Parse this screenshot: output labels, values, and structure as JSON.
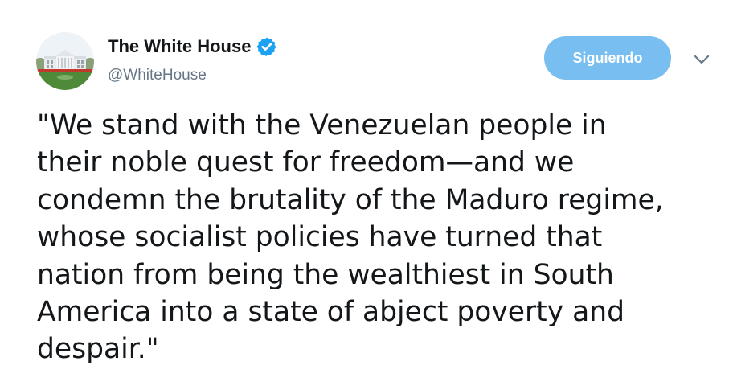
{
  "account": {
    "display_name": "The White House",
    "handle": "@WhiteHouse",
    "verified": true
  },
  "actions": {
    "follow_label": "Siguiendo",
    "menu_icon": "chevron-down-icon"
  },
  "tweet": {
    "lines": [
      "\"We stand with the Venezuelan people in",
      "their noble quest for freedom—and we",
      "condemn the brutality of the Maduro regime,",
      "whose socialist policies have turned that",
      "nation from being the wealthiest in South",
      "America into a state of abject poverty and",
      "despair.\""
    ]
  },
  "colors": {
    "follow_button_bg": "#79bef0",
    "verified_badge": "#1da1f2",
    "handle_text": "#657786",
    "body_text": "#14171a"
  }
}
